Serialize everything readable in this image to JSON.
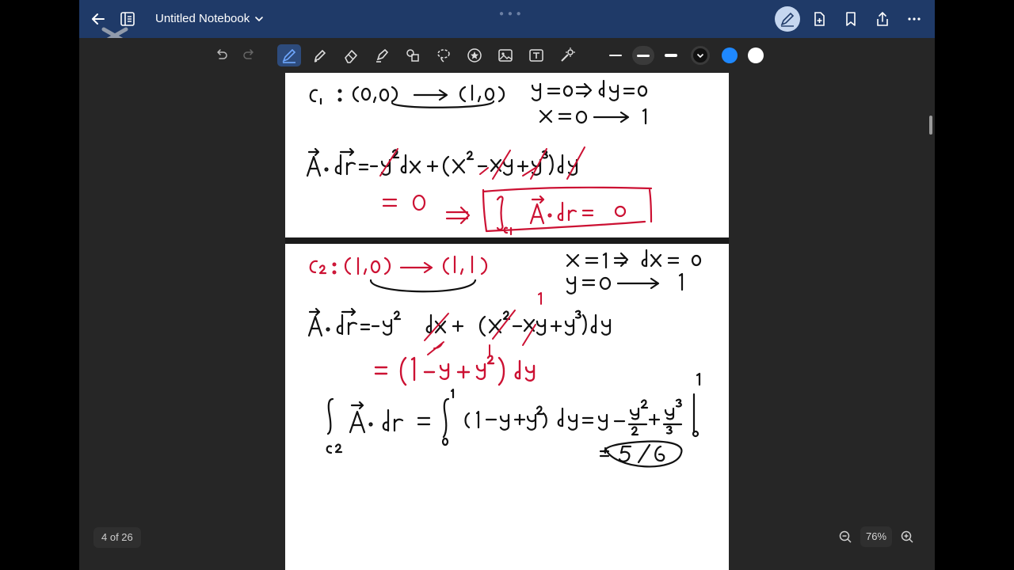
{
  "app": {
    "notebook_title": "Untitled Notebook",
    "page_indicator": "4 of 26",
    "zoom_level": "76%"
  },
  "header": {
    "icons": [
      "back-arrow-icon",
      "notebook-panel-icon",
      "pen-edit-icon",
      "add-page-icon",
      "bookmark-icon",
      "share-icon",
      "more-icon"
    ]
  },
  "toolbar": {
    "tools": [
      "undo-icon",
      "redo-icon",
      "pen-icon",
      "marker-icon",
      "eraser-icon",
      "highlighter-icon",
      "shapes-icon",
      "lasso-icon",
      "sticker-icon",
      "image-icon",
      "text-icon",
      "laser-icon"
    ],
    "selected_tool": "pen-icon",
    "colors": [
      "#1e88ff",
      "#ffffff"
    ],
    "pen_color": "#111111",
    "accent_ink": "#cc1133"
  }
}
